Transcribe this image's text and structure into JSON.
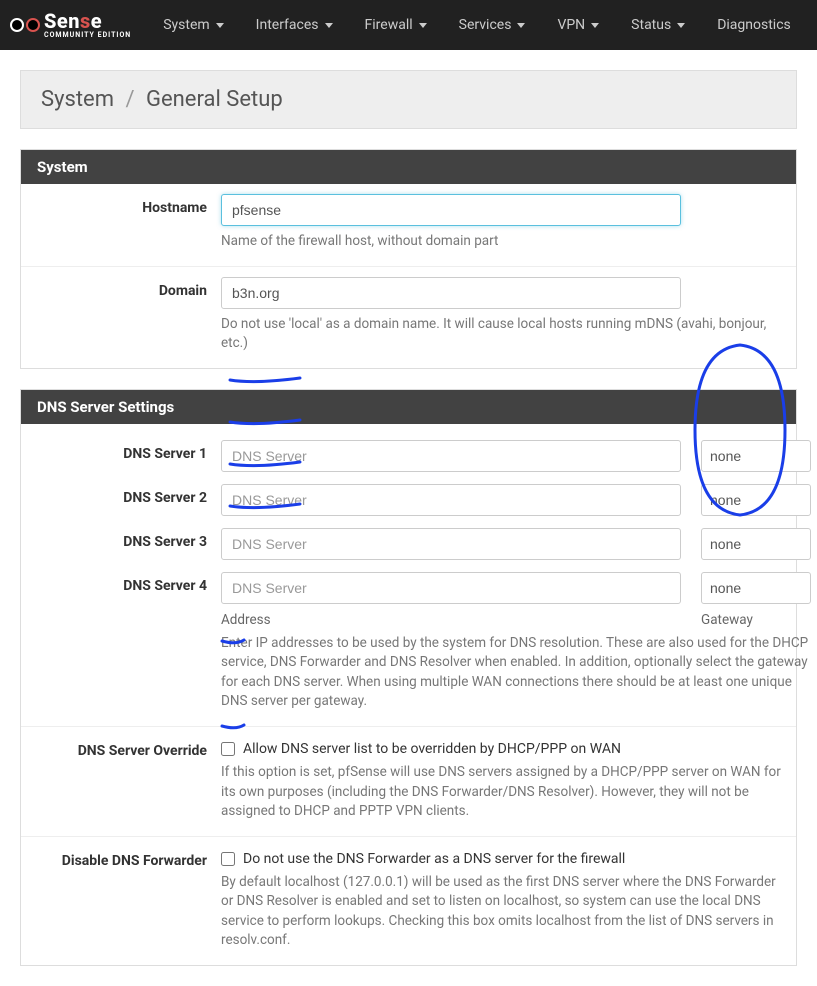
{
  "nav": {
    "items": [
      "System",
      "Interfaces",
      "Firewall",
      "Services",
      "VPN",
      "Status",
      "Diagnostics"
    ]
  },
  "breadcrumb": {
    "root": "System",
    "current": "General Setup"
  },
  "panels": {
    "system": {
      "title": "System",
      "hostname": {
        "label": "Hostname",
        "value": "pfsense",
        "help": "Name of the firewall host, without domain part"
      },
      "domain": {
        "label": "Domain",
        "value": "b3n.org",
        "help": "Do not use 'local' as a domain name. It will cause local hosts running mDNS (avahi, bonjour, etc.)"
      }
    },
    "dns": {
      "title": "DNS Server Settings",
      "servers": [
        {
          "label": "DNS Server 1",
          "placeholder": "DNS Server",
          "gateway": "none"
        },
        {
          "label": "DNS Server 2",
          "placeholder": "DNS Server",
          "gateway": "none"
        },
        {
          "label": "DNS Server 3",
          "placeholder": "DNS Server",
          "gateway": "none"
        },
        {
          "label": "DNS Server 4",
          "placeholder": "DNS Server",
          "gateway": "none"
        }
      ],
      "address_label": "Address",
      "gateway_label": "Gateway",
      "help": "Enter IP addresses to be used by the system for DNS resolution. These are also used for the DHCP service, DNS Forwarder and DNS Resolver when enabled.\nIn addition, optionally select the gateway for each DNS server. When using multiple WAN connections there should be at least one unique DNS server per gateway.",
      "override": {
        "label": "DNS Server Override",
        "checkbox_label": "Allow DNS server list to be overridden by DHCP/PPP on WAN",
        "help": "If this option is set, pfSense will use DNS servers assigned by a DHCP/PPP server on WAN for its own purposes (including the DNS Forwarder/DNS Resolver). However, they will not be assigned to DHCP and PPTP VPN clients."
      },
      "disable": {
        "label": "Disable DNS Forwarder",
        "checkbox_label": "Do not use the DNS Forwarder as a DNS server for the firewall",
        "help": "By default localhost (127.0.0.1) will be used as the first DNS server where the DNS Forwarder or DNS Resolver is enabled and set to listen on localhost, so system can use the local DNS service to perform lookups. Checking this box omits localhost from the list of DNS servers in resolv.conf."
      }
    }
  }
}
